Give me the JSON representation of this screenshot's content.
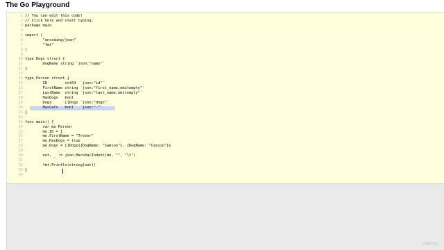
{
  "app": {
    "title": "The Go Playground"
  },
  "editor": {
    "lines": [
      {
        "n": "1",
        "text": "// You can edit this code!"
      },
      {
        "n": "2",
        "text": "// Click here and start typing."
      },
      {
        "n": "3",
        "text": "package main"
      },
      {
        "n": "4",
        "text": ""
      },
      {
        "n": "5",
        "text": "import ("
      },
      {
        "n": "6",
        "text": "\t\"encoding/json\""
      },
      {
        "n": "7",
        "text": "\t\"fmt\""
      },
      {
        "n": "8",
        "text": ")"
      },
      {
        "n": "9",
        "text": ""
      },
      {
        "n": "10",
        "text": "type Dogs struct {"
      },
      {
        "n": "11",
        "text": "\tDogName string `json:\"name\"`"
      },
      {
        "n": "12",
        "text": "}"
      },
      {
        "n": "13",
        "text": ""
      },
      {
        "n": "14",
        "text": "type Person struct {"
      },
      {
        "n": "15",
        "text": "\tID        int64  `json:\"id\"`"
      },
      {
        "n": "16",
        "text": "\tFirstName string `json:\"first_name,omitempty\"`"
      },
      {
        "n": "17",
        "text": "\tLastName  string `json:\"last_name,omitempty\"`"
      },
      {
        "n": "18",
        "text": "\tHasDogs   bool"
      },
      {
        "n": "19",
        "text": "\tDogs      []Dogs `json:\"dogs\"`"
      },
      {
        "n": "20",
        "text": "\tHasCats   bool   `json:\"-\"`"
      },
      {
        "n": "21",
        "text": "}"
      },
      {
        "n": "22",
        "text": ""
      },
      {
        "n": "23",
        "text": "func main() {"
      },
      {
        "n": "24",
        "text": "\tvar me Person"
      },
      {
        "n": "25",
        "text": "\tme.ID = 1"
      },
      {
        "n": "26",
        "text": "\tme.FirstName = \"Trevor\""
      },
      {
        "n": "27",
        "text": "\tme.HasDogs = true"
      },
      {
        "n": "28",
        "text": "\tme.Dogs = []Dogs{{DogName: \"Samson\"}, {DogName: \"Cassie\"}}"
      },
      {
        "n": "29",
        "text": ""
      },
      {
        "n": "30",
        "text": "\tout, _ := json.MarshalIndent(me, \"\", \"\\t\")"
      },
      {
        "n": "31",
        "text": ""
      },
      {
        "n": "32",
        "text": "\tfmt.Println(string(out))"
      },
      {
        "n": "33",
        "text": "}"
      },
      {
        "n": "34",
        "text": ""
      }
    ]
  },
  "watermark": "Udemy"
}
